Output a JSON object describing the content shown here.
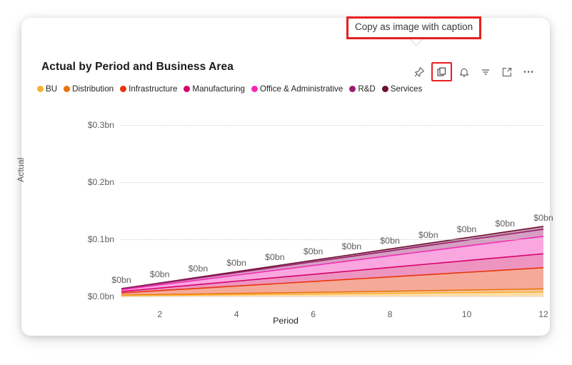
{
  "visual": {
    "title": "Actual by Period and Business Area"
  },
  "tooltip": {
    "text": "Copy as image with caption",
    "border_color": "#e8201f"
  },
  "toolbar": {
    "items": [
      {
        "name": "pin-icon",
        "label": "Pin to dashboard",
        "active": false
      },
      {
        "name": "copy-icon",
        "label": "Copy as image with caption",
        "active": true
      },
      {
        "name": "bell-icon",
        "label": "Alerts",
        "active": false
      },
      {
        "name": "filter-icon",
        "label": "Filters",
        "active": false
      },
      {
        "name": "focus-mode-icon",
        "label": "Focus mode",
        "active": false
      },
      {
        "name": "more-options-icon",
        "label": "More options",
        "active": false
      }
    ]
  },
  "legend": {
    "items": [
      {
        "label": "BU",
        "color": "#FBB034"
      },
      {
        "label": "Distribution",
        "color": "#E8740C"
      },
      {
        "label": "Infrastructure",
        "color": "#E8350C"
      },
      {
        "label": "Manufacturing",
        "color": "#D6006B"
      },
      {
        "label": "Office & Administrative",
        "color": "#F42BB2"
      },
      {
        "label": "R&D",
        "color": "#9B1C6E"
      },
      {
        "label": "Services",
        "color": "#6E1034"
      }
    ]
  },
  "chart_data": {
    "type": "area",
    "stacked": true,
    "title": "Actual by Period and Business Area",
    "xlabel": "Period",
    "ylabel": "Actual",
    "x": [
      1,
      2,
      3,
      4,
      5,
      6,
      7,
      8,
      9,
      10,
      11,
      12
    ],
    "xticks": [
      "2",
      "4",
      "6",
      "8",
      "10",
      "12"
    ],
    "xtick_values": [
      2,
      4,
      6,
      8,
      10,
      12
    ],
    "xlim": [
      1,
      12
    ],
    "yticks": [
      "$0.0bn",
      "$0.1bn",
      "$0.2bn",
      "$0.3bn"
    ],
    "ytick_values": [
      0,
      0.1,
      0.2,
      0.3
    ],
    "ylim": [
      0,
      0.3
    ],
    "grid": true,
    "legend_position": "top",
    "data_labels": [
      "$0bn",
      "$0bn",
      "$0bn",
      "$0bn",
      "$0bn",
      "$0bn",
      "$0bn",
      "$0bn",
      "$0bn",
      "$0bn",
      "$0bn",
      "$0bn"
    ],
    "series": [
      {
        "name": "BU",
        "color": "#FBB034",
        "values": [
          0.0012,
          0.0018,
          0.0024,
          0.003,
          0.0036,
          0.0042,
          0.0048,
          0.0054,
          0.006,
          0.0066,
          0.0072,
          0.0078
        ]
      },
      {
        "name": "Distribution",
        "color": "#E8740C",
        "values": [
          0.001,
          0.0014,
          0.0018,
          0.0022,
          0.0026,
          0.003,
          0.0034,
          0.0038,
          0.0042,
          0.0046,
          0.005,
          0.0054
        ]
      },
      {
        "name": "Infrastructure",
        "color": "#E8350C",
        "values": [
          0.004,
          0.007,
          0.01,
          0.013,
          0.016,
          0.019,
          0.022,
          0.025,
          0.028,
          0.031,
          0.034,
          0.037
        ]
      },
      {
        "name": "Manufacturing",
        "color": "#D6006B",
        "values": [
          0.0025,
          0.0045,
          0.0065,
          0.0085,
          0.0105,
          0.0125,
          0.0145,
          0.0165,
          0.0185,
          0.0205,
          0.0225,
          0.0245
        ]
      },
      {
        "name": "Office & Administrative",
        "color": "#F42BB2",
        "values": [
          0.003,
          0.0055,
          0.008,
          0.0105,
          0.013,
          0.0155,
          0.018,
          0.0205,
          0.023,
          0.0255,
          0.028,
          0.0305
        ]
      },
      {
        "name": "R&D",
        "color": "#9B1C6E",
        "values": [
          0.0014,
          0.0024,
          0.0034,
          0.0044,
          0.0054,
          0.0064,
          0.0074,
          0.0084,
          0.0094,
          0.0104,
          0.0114,
          0.0124
        ]
      },
      {
        "name": "Services",
        "color": "#6E1034",
        "values": [
          0.0006,
          0.001,
          0.0014,
          0.0018,
          0.0022,
          0.0026,
          0.003,
          0.0034,
          0.0038,
          0.0042,
          0.0046,
          0.005
        ]
      }
    ],
    "totals": [
      0.0137,
      0.0236,
      0.0335,
      0.0434,
      0.0533,
      0.0632,
      0.0731,
      0.083,
      0.0929,
      0.1028,
      0.1127,
      0.1226
    ]
  }
}
